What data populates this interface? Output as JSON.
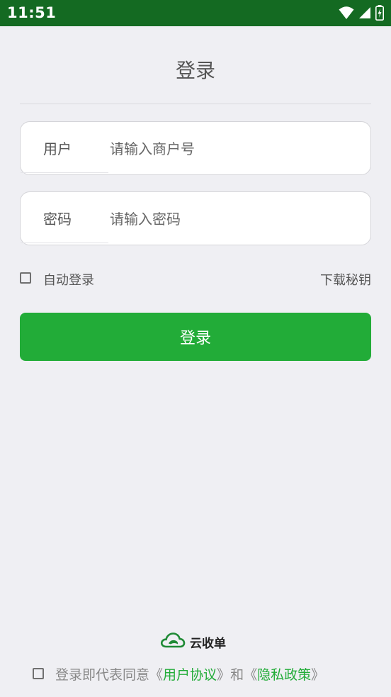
{
  "status_bar": {
    "time": "11:51",
    "icons": [
      "wifi-icon",
      "signal-icon",
      "battery-charging-icon"
    ]
  },
  "header": {
    "title": "登录"
  },
  "form": {
    "user": {
      "label": "用户",
      "placeholder": "请输入商户号",
      "value": ""
    },
    "password": {
      "label": "密码",
      "placeholder": "请输入密码",
      "value": ""
    },
    "auto_login": {
      "label": "自动登录",
      "checked": false
    },
    "download_key_label": "下载秘钥",
    "login_button_label": "登录"
  },
  "footer": {
    "brand_name": "云收单",
    "agreement": {
      "checked": false,
      "prefix": "登录即代表同意",
      "open_quote_1": "《",
      "user_agreement": "用户协议",
      "close_quote_1": "》",
      "conjunction": "和",
      "open_quote_2": "《",
      "privacy_policy": "隐私政策",
      "close_quote_2": "》"
    }
  },
  "colors": {
    "status_bar": "#146a22",
    "accent": "#22ac38",
    "background": "#efeff3"
  }
}
